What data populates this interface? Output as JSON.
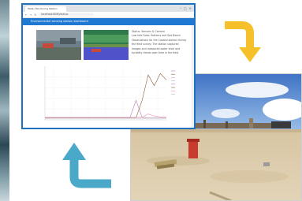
{
  "browser": {
    "tab_title": "Water Monitoring Station",
    "url": "localhost:8080/status",
    "header_text": "Environmental sensing station dashboard"
  },
  "description_lines": [
    "Status: Sensors & Camera",
    "Low tide Data: Stations and Sed Beach",
    "Observations for the Coastal station during",
    "the field survey. The station captured",
    "images and measured water level and",
    "turbidity trends over time in the field."
  ],
  "chart_data": {
    "type": "line",
    "title": "",
    "xlabel": "",
    "ylabel": "",
    "x_tick_labels": [
      "",
      "",
      "",
      "",
      "",
      "",
      ""
    ],
    "legend": [
      "",
      "",
      "",
      "",
      "",
      "",
      "",
      ""
    ],
    "series": [
      {
        "color": "#c07ab8",
        "values": [
          4,
          4,
          4,
          4,
          4,
          4,
          4,
          4,
          4,
          4,
          4,
          4,
          4,
          4,
          4,
          40,
          5,
          4,
          4,
          4,
          4
        ]
      },
      {
        "color": "#8c5e3c",
        "values": [
          4,
          4,
          4,
          4,
          4,
          4,
          4,
          4,
          4,
          4,
          4,
          4,
          4,
          4,
          4,
          4,
          40,
          92,
          70,
          95,
          82
        ]
      },
      {
        "color": "#e58fb0",
        "values": [
          5,
          5,
          5,
          5,
          5,
          5,
          5,
          5,
          5,
          5,
          5,
          5,
          5,
          5,
          5,
          5,
          5,
          12,
          8,
          6,
          6
        ]
      },
      {
        "color": "#b5b5b5",
        "values": [
          3,
          3,
          3,
          3,
          3,
          3,
          3,
          3,
          3,
          3,
          3,
          3,
          3,
          3,
          3,
          3,
          3,
          3,
          3,
          3,
          3
        ]
      }
    ],
    "ylim": [
      0,
      110
    ],
    "grid": true
  },
  "colors": {
    "window_border": "#2170bd",
    "header_bar": "#1f78d1",
    "arrow_yellow": "#f6c02a",
    "arrow_blue": "#4aa8c9"
  },
  "icons": {
    "arrow_right_down": "curved-arrow-down-icon",
    "arrow_left_up": "curved-arrow-up-icon"
  }
}
